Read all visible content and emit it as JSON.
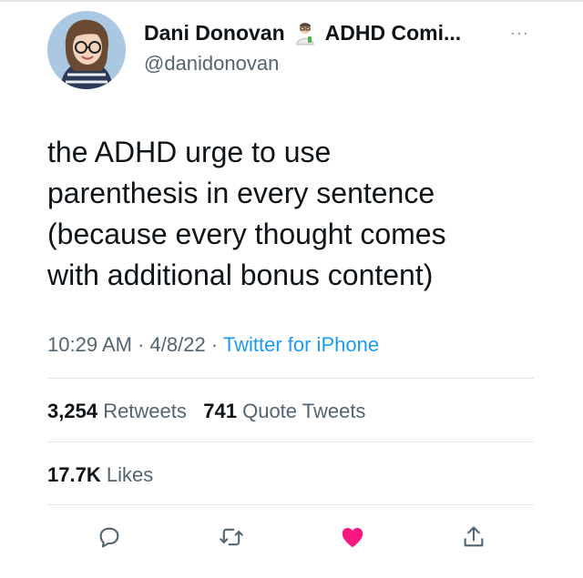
{
  "author": {
    "display_name": "Dani Donovan",
    "name_suffix": "ADHD Comi...",
    "handle": "@danidonovan",
    "more_label": "···"
  },
  "tweet": {
    "lines": [
      "the ADHD urge to use",
      "parenthesis in every sentence",
      "(because every thought comes",
      "with additional bonus content)"
    ],
    "time": "10:29 AM",
    "date": "4/8/22",
    "separator": "·",
    "source": "Twitter for iPhone"
  },
  "stats": {
    "retweets_count": "3,254",
    "retweets_label": "Retweets",
    "quote_count": "741",
    "quote_label": "Quote Tweets",
    "likes_count": "17.7K",
    "likes_label": "Likes"
  },
  "colors": {
    "link": "#1d9bf0",
    "like": "#f91880",
    "muted": "#536471"
  },
  "icons": [
    "reply-icon",
    "retweet-icon",
    "like-icon",
    "share-icon"
  ]
}
